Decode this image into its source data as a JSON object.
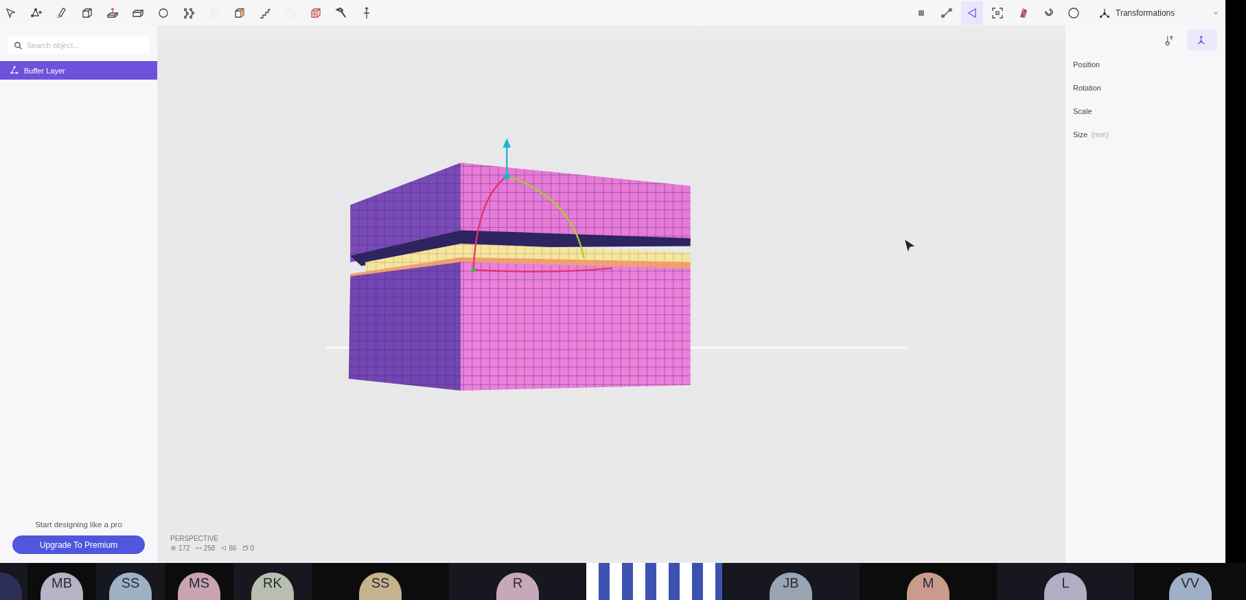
{
  "toolbar": {
    "left_tools": [
      {
        "selected": false,
        "disabled": false
      },
      {
        "selected": false,
        "disabled": false
      },
      {
        "selected": false,
        "disabled": false
      },
      {
        "selected": false,
        "disabled": false
      },
      {
        "selected": false,
        "disabled": false
      },
      {
        "selected": false,
        "disabled": false
      },
      {
        "selected": false,
        "disabled": false
      },
      {
        "selected": false,
        "disabled": false
      },
      {
        "selected": false,
        "disabled": true
      },
      {
        "selected": false,
        "disabled": false
      },
      {
        "selected": false,
        "disabled": false
      },
      {
        "selected": false,
        "disabled": true
      },
      {
        "selected": false,
        "disabled": false
      },
      {
        "selected": false,
        "disabled": false
      },
      {
        "selected": false,
        "disabled": false
      }
    ],
    "right_tools": [
      {
        "selected": false
      },
      {
        "selected": false
      },
      {
        "selected": true
      },
      {
        "selected": false
      },
      {
        "selected": false
      },
      {
        "selected": false
      },
      {
        "selected": false
      }
    ],
    "mode_menu": {
      "label": "Transformations"
    }
  },
  "sidebar": {
    "search": {
      "placeholder": "Search object..."
    },
    "items": [
      {
        "label": "Buffer Layer",
        "selected": true
      }
    ],
    "promo": {
      "text": "Start designing like a pro",
      "button": "Upgrade To Premium"
    }
  },
  "viewport": {
    "camera": "PERSPECTIVE",
    "stats": [
      "172",
      "258",
      "86",
      "0"
    ]
  },
  "properties": {
    "tabs": [
      {
        "selected": false
      },
      {
        "selected": true
      }
    ],
    "rows": [
      {
        "label": "Position"
      },
      {
        "label": "Rotation"
      },
      {
        "label": "Scale"
      },
      {
        "label": "Size",
        "unit": "(mm)"
      }
    ]
  },
  "participants": [
    {
      "kind": "avatar",
      "color": "#2c2f58"
    },
    {
      "kind": "avatar",
      "initials": "MB",
      "color": "#b8b2c6"
    },
    {
      "kind": "avatar",
      "initials": "SS",
      "color": "#9eb0c3"
    },
    {
      "kind": "avatar",
      "initials": "MS",
      "color": "#c9a3af"
    },
    {
      "kind": "avatar",
      "initials": "RK",
      "color": "#b9bfb0"
    },
    {
      "kind": "avatar",
      "initials": "SS",
      "color": "#c4b38d"
    },
    {
      "kind": "avatar",
      "initials": "R",
      "color": "#c7a8b8"
    },
    {
      "kind": "video"
    },
    {
      "kind": "avatar",
      "initials": "JB",
      "color": "#99a5b3"
    },
    {
      "kind": "avatar",
      "initials": "M",
      "color": "#c89b8d"
    },
    {
      "kind": "avatar",
      "initials": "L",
      "color": "#b1adc3"
    },
    {
      "kind": "avatar",
      "initials": "VV",
      "color": "#9eafc7"
    }
  ]
}
